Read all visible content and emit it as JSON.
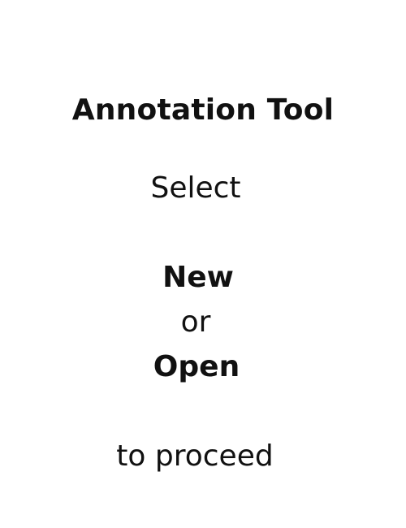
{
  "app": {
    "title": "Annotation Tool"
  },
  "instructions": {
    "line1": "Select",
    "option_new": "New",
    "connector": "or",
    "option_open": "Open",
    "line_end": "to proceed"
  },
  "colors": {
    "background": "#ffffff",
    "text": "#111111"
  }
}
